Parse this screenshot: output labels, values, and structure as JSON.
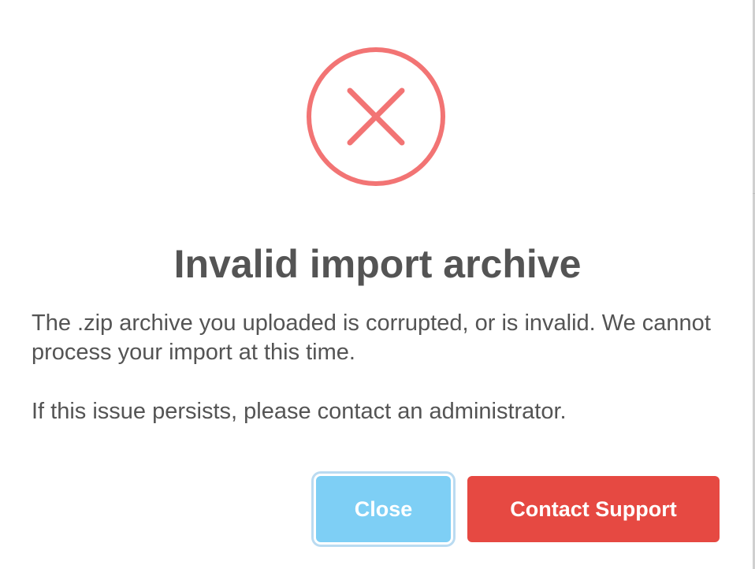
{
  "dialog": {
    "icon": "error-x-circle-icon",
    "title": "Invalid import archive",
    "message_1": "The .zip archive you uploaded is corrupted, or is invalid. We cannot process your import at this time.",
    "message_2": "If this issue persists, please contact an administrator."
  },
  "buttons": {
    "close_label": "Close",
    "support_label": "Contact Support"
  },
  "colors": {
    "error_icon": "#f27474",
    "title_text": "#545454",
    "close_button": "#7ecff5",
    "support_button": "#e64942"
  }
}
